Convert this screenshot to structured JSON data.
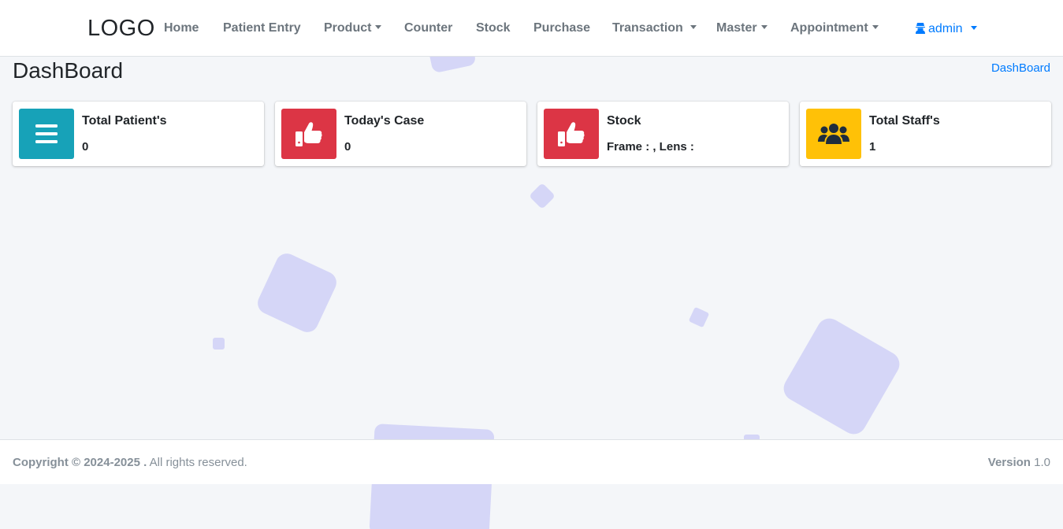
{
  "brand": {
    "logo_text": "LOGO"
  },
  "nav": {
    "home": "Home",
    "patient_entry": "Patient Entry",
    "product": "Product",
    "counter": "Counter",
    "stock": "Stock",
    "purchase": "Purchase",
    "transaction": "Transaction",
    "master": "Master",
    "appointment": "Appointment",
    "user": "admin"
  },
  "header": {
    "title": "DashBoard",
    "breadcrumb": "DashBoard"
  },
  "cards": [
    {
      "title": "Total Patient's",
      "value": "0",
      "icon": "bars-icon",
      "color": "#17a2b8"
    },
    {
      "title": "Today's Case",
      "value": "0",
      "icon": "thumbs-up-icon",
      "color": "#dc3545"
    },
    {
      "title": "Stock",
      "value": "Frame : , Lens :",
      "icon": "thumbs-up-icon",
      "color": "#dc3545"
    },
    {
      "title": "Total Staff's",
      "value": "1",
      "icon": "users-icon",
      "color": "#ffc107"
    }
  ],
  "footer": {
    "copyright_bold": "Copyright © 2024-2025 .",
    "copyright_rest": " All rights reserved.",
    "version_label": "Version",
    "version_value": "1.0"
  },
  "colors": {
    "accent": "#007bff",
    "background": "#f4f6f9",
    "decor": "#d5d6f7"
  }
}
